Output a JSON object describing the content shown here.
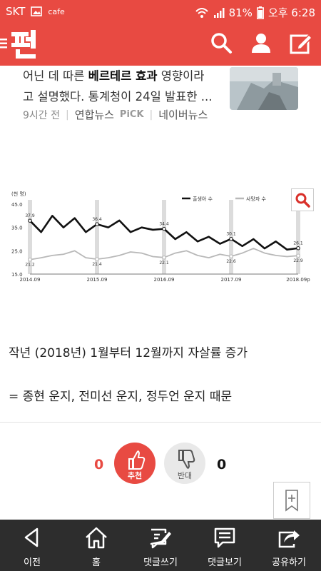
{
  "statusbar": {
    "carrier": "SKT",
    "app": "cafe",
    "battery": "81%",
    "time": "오후 6:28"
  },
  "article": {
    "snippet_pre": "어닌 데 따른 ",
    "snippet_bold1": "베르테르 효과",
    "snippet_mid": " 영향이라",
    "snippet_line2": "고 설명했다. 통계청이 24일 발표한 ...",
    "time_ago": "9시간 전",
    "source": "연합뉴스",
    "pick": "PiCK",
    "portal": "네이버뉴스"
  },
  "chart_data": {
    "type": "line",
    "unit_label": "(천 명)",
    "y_ticks": [
      "45.0",
      "35.0",
      "25.0",
      "15.0"
    ],
    "ylim": [
      15,
      45
    ],
    "x_ticks": [
      "2014.09",
      "2015.09",
      "2016.09",
      "2017.09",
      "2018.09p"
    ],
    "legend": [
      "출생아 수",
      "사망자 수"
    ],
    "legend_position": "top-right",
    "series": [
      {
        "name": "출생아 수",
        "color": "#111111",
        "x": [
          0,
          2,
          4,
          6,
          8,
          10,
          12,
          14,
          16,
          18,
          20,
          22,
          24,
          26,
          28,
          30,
          32,
          34,
          36,
          38,
          40,
          42,
          44,
          46,
          48
        ],
        "values": [
          37.9,
          33,
          40,
          35,
          39,
          33,
          36.4,
          35,
          38,
          33,
          35,
          34,
          34.4,
          30,
          33,
          29,
          31,
          28,
          30.1,
          27,
          30,
          26,
          29,
          25.5,
          26.1
        ],
        "labels": [
          {
            "i": 0,
            "v": "37.9"
          },
          {
            "i": 6,
            "v": "36.4"
          },
          {
            "i": 12,
            "v": "34.4"
          },
          {
            "i": 18,
            "v": "30.1"
          },
          {
            "i": 24,
            "v": "26.1"
          }
        ]
      },
      {
        "name": "사망자 수",
        "color": "#b8b8b8",
        "x": [
          0,
          2,
          4,
          6,
          8,
          10,
          12,
          14,
          16,
          18,
          20,
          22,
          24,
          26,
          28,
          30,
          32,
          34,
          36,
          38,
          40,
          42,
          44,
          46,
          48
        ],
        "values": [
          21.2,
          22,
          23,
          23.5,
          25,
          22,
          21.4,
          22,
          23,
          24.5,
          24,
          22.5,
          22.1,
          24,
          25,
          23,
          22,
          23.5,
          22.6,
          24,
          26,
          24,
          23,
          22.5,
          22.9
        ],
        "labels": [
          {
            "i": 0,
            "v": "21.2"
          },
          {
            "i": 6,
            "v": "21.4"
          },
          {
            "i": 12,
            "v": "22.1"
          },
          {
            "i": 18,
            "v": "22.6"
          },
          {
            "i": 24,
            "v": "22.9"
          }
        ]
      }
    ]
  },
  "post": {
    "line1": "작년 (2018년) 1월부터 12월까지 자살률 증가",
    "line2": "= 종현 운지, 전미선 운지, 정두언 운지 때문"
  },
  "votes": {
    "up_count": "0",
    "up_label": "추천",
    "down_label": "반대",
    "down_count": "0",
    "up_color": "#e84a42"
  },
  "nav": [
    {
      "label": "이전",
      "icon": "back-icon"
    },
    {
      "label": "홈",
      "icon": "home-icon"
    },
    {
      "label": "댓글쓰기",
      "icon": "write-comment-icon"
    },
    {
      "label": "댓글보기",
      "icon": "view-comments-icon"
    },
    {
      "label": "공유하기",
      "icon": "share-icon"
    }
  ]
}
